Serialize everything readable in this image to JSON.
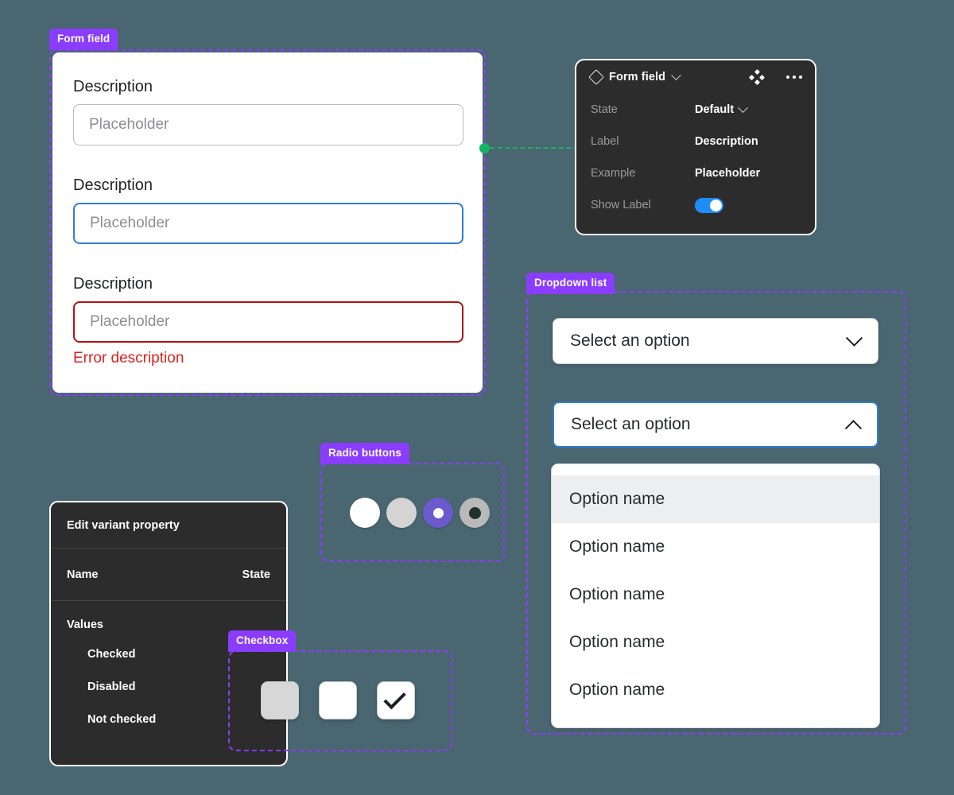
{
  "canvas": {
    "background_color": "#4a6670",
    "annotation_color": "#8b3dff"
  },
  "form_field": {
    "badge": "Form field",
    "fields": [
      {
        "label": "Description",
        "placeholder": "Placeholder",
        "state": "default"
      },
      {
        "label": "Description",
        "placeholder": "Placeholder",
        "state": "focus"
      },
      {
        "label": "Description",
        "placeholder": "Placeholder",
        "state": "error",
        "error_text": "Error description"
      }
    ]
  },
  "properties_panel": {
    "title": "Form field",
    "icons": {
      "component": "diamond-icon",
      "expand": "chevron-down-icon",
      "move": "move-icon",
      "more": "ellipsis-icon"
    },
    "rows": [
      {
        "key": "State",
        "value": "Default",
        "type": "select"
      },
      {
        "key": "Label",
        "value": "Description",
        "type": "text"
      },
      {
        "key": "Example",
        "value": "Placeholder",
        "type": "text"
      },
      {
        "key": "Show Label",
        "value": "on",
        "type": "toggle"
      }
    ],
    "toggle_color": "#1f8df5"
  },
  "connector": {
    "dot_color": "#16b364",
    "line_color": "#16b364"
  },
  "dropdown": {
    "badge": "Dropdown list",
    "closed": {
      "value": "Select an option",
      "icon": "chevron-down-icon",
      "state": "default"
    },
    "open": {
      "value": "Select an option",
      "icon": "chevron-up-icon",
      "state": "focus"
    },
    "options": [
      {
        "label": "Option name",
        "highlighted": true
      },
      {
        "label": "Option name",
        "highlighted": false
      },
      {
        "label": "Option name",
        "highlighted": false
      },
      {
        "label": "Option name",
        "highlighted": false
      },
      {
        "label": "Option name",
        "highlighted": false
      }
    ]
  },
  "radio": {
    "badge": "Radio buttons",
    "items": [
      {
        "state": "unchecked",
        "color": "#ffffff"
      },
      {
        "state": "disabled",
        "color": "#d4d4d4"
      },
      {
        "state": "checked",
        "color": "#6a5acd"
      },
      {
        "state": "checked-disabled",
        "color": "#b9b9b9"
      }
    ]
  },
  "checkbox": {
    "badge": "Checkbox",
    "items": [
      {
        "state": "disabled",
        "checked": false
      },
      {
        "state": "default",
        "checked": false
      },
      {
        "state": "checked",
        "checked": true
      }
    ]
  },
  "variant_panel": {
    "title": "Edit variant property",
    "name_key": "Name",
    "name_value": "State",
    "values_header": "Values",
    "values": [
      "Checked",
      "Disabled",
      "Not checked"
    ]
  }
}
